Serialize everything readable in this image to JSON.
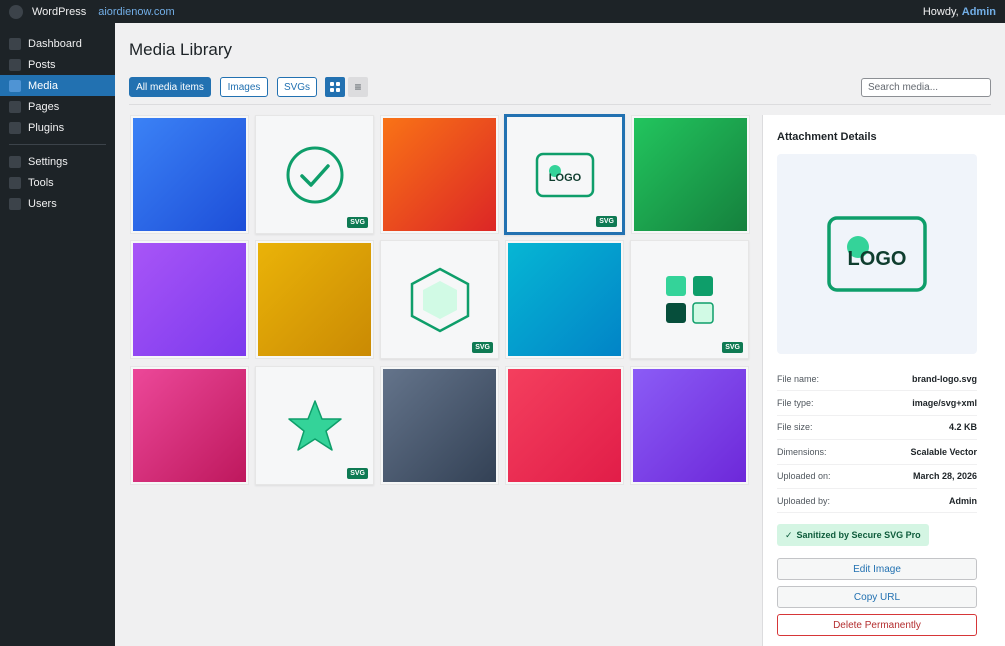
{
  "adminbar": {
    "site_name": "WordPress",
    "site_url": "aiordienow.com",
    "howdy_prefix": "Howdy, ",
    "user": "Admin"
  },
  "sidebar": {
    "items": [
      {
        "label": "Dashboard"
      },
      {
        "label": "Posts"
      },
      {
        "label": "Media",
        "active": true
      },
      {
        "label": "Pages"
      },
      {
        "label": "Plugins"
      },
      {
        "label": "Settings"
      },
      {
        "label": "Tools"
      },
      {
        "label": "Users"
      }
    ]
  },
  "page": {
    "title": "Media Library"
  },
  "filters": {
    "all": "All media items",
    "images": "Images",
    "svgs": "SVGs",
    "list_glyph": "≡",
    "active": "all"
  },
  "search": {
    "placeholder": "Search media..."
  },
  "colors": {
    "accent": "#2271b1",
    "svg_green": "#0e9e6a",
    "badge_green": "#0e7a53"
  },
  "media": [
    {
      "kind": "gradient",
      "from": "#3b82f6",
      "to": "#1d4ed8"
    },
    {
      "kind": "svg",
      "icon": "check-circle-icon",
      "badge": "SVG"
    },
    {
      "kind": "gradient",
      "from": "#f97316",
      "to": "#dc2626"
    },
    {
      "kind": "svg",
      "icon": "logo-icon",
      "badge": "SVG",
      "selected": true
    },
    {
      "kind": "gradient",
      "from": "#22c55e",
      "to": "#15803d"
    },
    {
      "kind": "gradient",
      "from": "#a855f7",
      "to": "#7c3aed"
    },
    {
      "kind": "gradient",
      "from": "#eab308",
      "to": "#ca8a04"
    },
    {
      "kind": "svg",
      "icon": "hexagon-icon",
      "badge": "SVG"
    },
    {
      "kind": "gradient",
      "from": "#06b6d4",
      "to": "#0284c7"
    },
    {
      "kind": "svg",
      "icon": "app-grid-icon",
      "badge": "SVG"
    },
    {
      "kind": "gradient",
      "from": "#ec4899",
      "to": "#be185d"
    },
    {
      "kind": "svg",
      "icon": "star-icon",
      "badge": "SVG"
    },
    {
      "kind": "gradient",
      "from": "#64748b",
      "to": "#334155"
    },
    {
      "kind": "gradient",
      "from": "#f43f5e",
      "to": "#e11d48"
    },
    {
      "kind": "gradient",
      "from": "#8b5cf6",
      "to": "#6d28d9"
    }
  ],
  "details": {
    "title": "Attachment Details",
    "preview_logo_text": "LOGO",
    "fields": [
      {
        "label": "File name:",
        "value": "brand-logo.svg"
      },
      {
        "label": "File type:",
        "value": "image/svg+xml"
      },
      {
        "label": "File size:",
        "value": "4.2 KB"
      },
      {
        "label": "Dimensions:",
        "value": "Scalable Vector"
      },
      {
        "label": "Uploaded on:",
        "value": "March 28, 2026"
      },
      {
        "label": "Uploaded by:",
        "value": "Admin"
      }
    ],
    "sanitized": "Sanitized by Secure SVG Pro",
    "sanitized_check": "✓",
    "edit": "Edit Image",
    "copy": "Copy URL",
    "delete": "Delete Permanently"
  }
}
